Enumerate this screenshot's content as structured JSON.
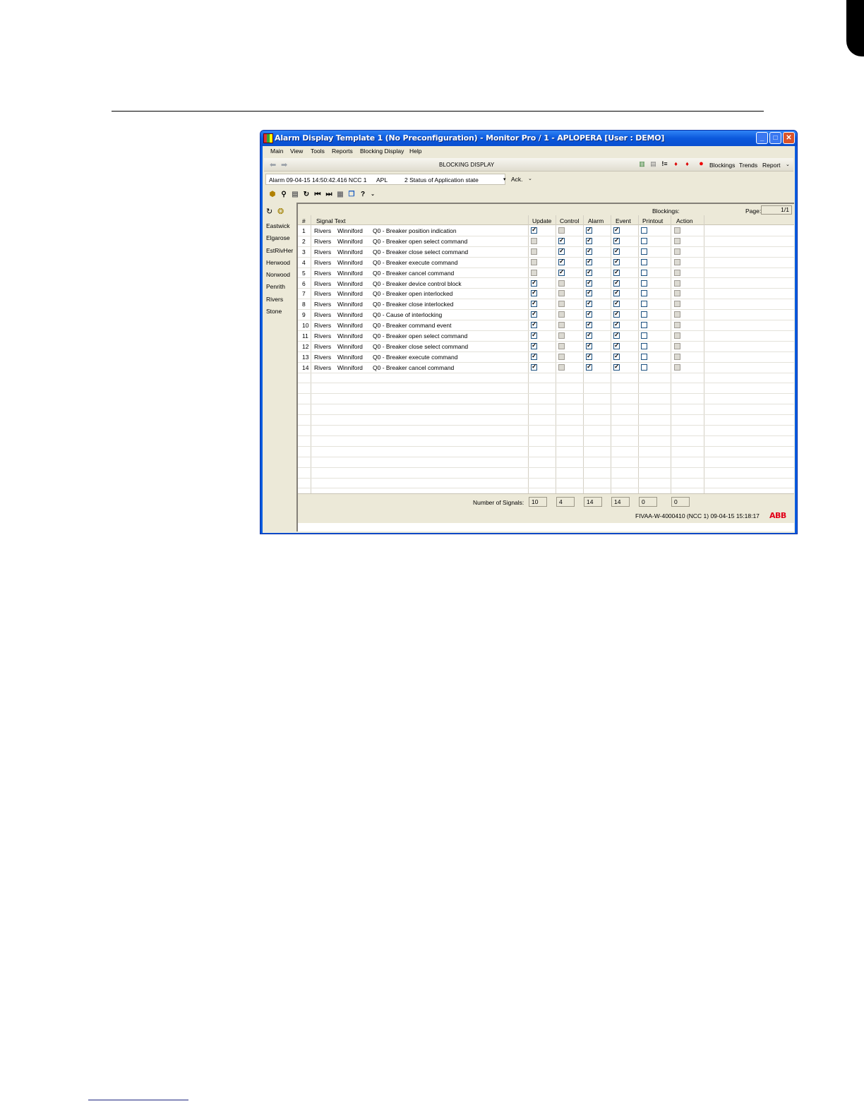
{
  "window": {
    "title": "Alarm Display Template 1 (No Preconfiguration) - Monitor Pro / 1 - APLOPERA [User : DEMO]"
  },
  "menu": [
    "Main",
    "View",
    "Tools",
    "Reports",
    "Blocking Display",
    "Help"
  ],
  "toolbar": {
    "display_title": "BLOCKING DISPLAY",
    "links": [
      "Blockings",
      "Trends",
      "Report"
    ]
  },
  "alarm_bar": {
    "text": "Alarm 09-04-15 14:50:42.416 NCC 1",
    "object": "APL",
    "description": "2 Status of Application state",
    "ack_label": "Ack."
  },
  "sidebar": {
    "items": [
      "Eastwick",
      "Elgarose",
      "EstRivHer",
      "Herwood",
      "Norwood",
      "Penrith",
      "Rivers",
      "Stone"
    ]
  },
  "info": {
    "blockings_label": "Blockings:",
    "page_label": "Page:",
    "page_value": "1/1"
  },
  "columns": {
    "num": "#",
    "signal_text": "Signal Text",
    "update": "Update",
    "control": "Control",
    "alarm": "Alarm",
    "event": "Event",
    "printout": "Printout",
    "action": "Action"
  },
  "rows": [
    {
      "n": "1",
      "station": "Rivers",
      "bay": "Winniford",
      "text": "Q0 - Breaker position indication",
      "update": true,
      "control": false,
      "alarm": true,
      "event": true,
      "printout": false,
      "action": false
    },
    {
      "n": "2",
      "station": "Rivers",
      "bay": "Winniford",
      "text": "Q0 - Breaker open select command",
      "update": false,
      "control": true,
      "alarm": true,
      "event": true,
      "printout": false,
      "action": false
    },
    {
      "n": "3",
      "station": "Rivers",
      "bay": "Winniford",
      "text": "Q0 - Breaker close select command",
      "update": false,
      "control": true,
      "alarm": true,
      "event": true,
      "printout": false,
      "action": false
    },
    {
      "n": "4",
      "station": "Rivers",
      "bay": "Winniford",
      "text": "Q0 - Breaker execute command",
      "update": false,
      "control": true,
      "alarm": true,
      "event": true,
      "printout": false,
      "action": false
    },
    {
      "n": "5",
      "station": "Rivers",
      "bay": "Winniford",
      "text": "Q0 - Breaker cancel command",
      "update": false,
      "control": true,
      "alarm": true,
      "event": true,
      "printout": false,
      "action": false
    },
    {
      "n": "6",
      "station": "Rivers",
      "bay": "Winniford",
      "text": "Q0 - Breaker device control block",
      "update": true,
      "control": false,
      "alarm": true,
      "event": true,
      "printout": false,
      "action": false
    },
    {
      "n": "7",
      "station": "Rivers",
      "bay": "Winniford",
      "text": "Q0 - Breaker open interlocked",
      "update": true,
      "control": false,
      "alarm": true,
      "event": true,
      "printout": false,
      "action": false
    },
    {
      "n": "8",
      "station": "Rivers",
      "bay": "Winniford",
      "text": "Q0 - Breaker close interlocked",
      "update": true,
      "control": false,
      "alarm": true,
      "event": true,
      "printout": false,
      "action": false
    },
    {
      "n": "9",
      "station": "Rivers",
      "bay": "Winniford",
      "text": "Q0 - Cause of interlocking",
      "update": true,
      "control": false,
      "alarm": true,
      "event": true,
      "printout": false,
      "action": false
    },
    {
      "n": "10",
      "station": "Rivers",
      "bay": "Winniford",
      "text": "Q0 - Breaker command event",
      "update": true,
      "control": false,
      "alarm": true,
      "event": true,
      "printout": false,
      "action": false
    },
    {
      "n": "11",
      "station": "Rivers",
      "bay": "Winniford",
      "text": "Q0 - Breaker open select command",
      "update": true,
      "control": false,
      "alarm": true,
      "event": true,
      "printout": false,
      "action": false
    },
    {
      "n": "12",
      "station": "Rivers",
      "bay": "Winniford",
      "text": "Q0 - Breaker close select command",
      "update": true,
      "control": false,
      "alarm": true,
      "event": true,
      "printout": false,
      "action": false
    },
    {
      "n": "13",
      "station": "Rivers",
      "bay": "Winniford",
      "text": "Q0 - Breaker execute command",
      "update": true,
      "control": false,
      "alarm": true,
      "event": true,
      "printout": false,
      "action": false
    },
    {
      "n": "14",
      "station": "Rivers",
      "bay": "Winniford",
      "text": "Q0 - Breaker cancel command",
      "update": true,
      "control": false,
      "alarm": true,
      "event": true,
      "printout": false,
      "action": false
    }
  ],
  "footer": {
    "count_label": "Number of Signals:",
    "counts": [
      "10",
      "4",
      "14",
      "14",
      "0",
      "0"
    ]
  },
  "status": {
    "text": "FIVAA-W-4000410 (NCC 1)   09-04-15 15:18:17",
    "logo": "ABB"
  },
  "colors": {
    "title_bar": "#0b58dc",
    "client": "#ece9d8",
    "abb_red": "#e2001a"
  }
}
